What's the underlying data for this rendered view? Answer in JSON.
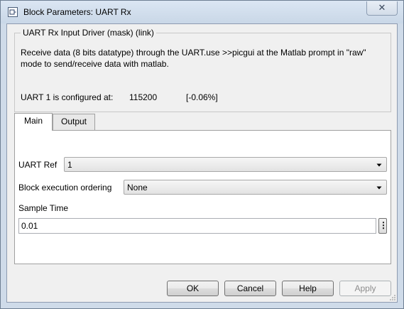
{
  "window": {
    "title": "Block Parameters: UART Rx",
    "close_glyph": "✕"
  },
  "group": {
    "title": "UART Rx Input Driver (mask) (link)",
    "description": "Receive data (8 bits datatype) through the UART.use >>picgui at the Matlab prompt in \"raw\" mode to send/receive data with matlab.",
    "uart_label": "UART 1 is configured at:",
    "uart_baud": "115200",
    "uart_error": "[-0.06%]"
  },
  "tabs": [
    {
      "label": "Main",
      "active": true
    },
    {
      "label": "Output",
      "active": false
    }
  ],
  "main": {
    "uart_ref_label": "UART Ref",
    "uart_ref_value": "1",
    "order_label": "Block execution ordering",
    "order_value": "None",
    "sample_time_label": "Sample Time",
    "sample_time_value": "0.01",
    "more_glyph": "⋮"
  },
  "buttons": {
    "ok": "OK",
    "cancel": "Cancel",
    "help": "Help",
    "apply": "Apply"
  }
}
